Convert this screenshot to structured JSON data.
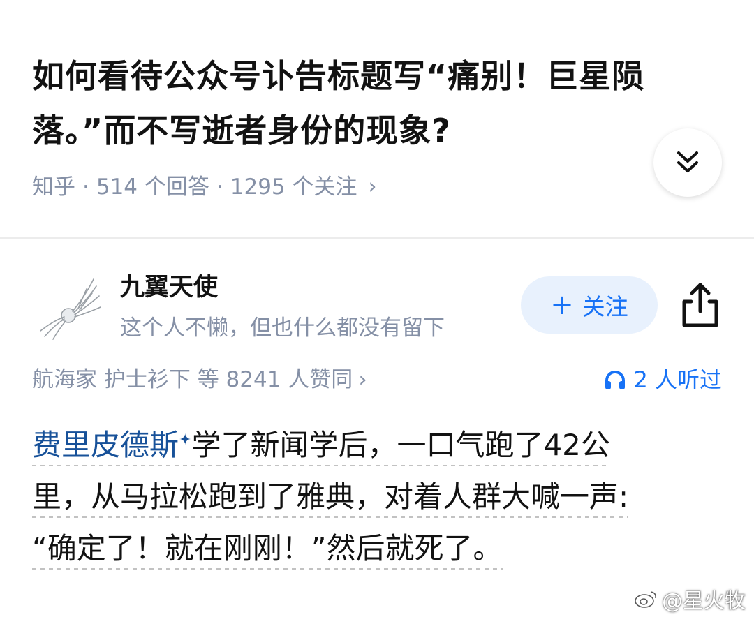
{
  "question": {
    "title": "如何看待公众号讣告标题写“痛别！巨星陨落。”而不写逝者身份的现象?",
    "source": "知乎",
    "answers": "514 个回答",
    "followers": "1295 个关注",
    "meta_separator": "·"
  },
  "author": {
    "name": "九翼天使",
    "bio": "这个人不懒，但也什么都没有留下",
    "follow_label": "关注"
  },
  "answer": {
    "upvote_text": "航海家 护士衫下 等 8241 人赞同",
    "listened_text": "2 人听过",
    "link_text": "费里皮德斯",
    "lines": [
      "学了新闻学后，一口气跑了42公",
      "里，从马拉松跑到了雅典，对着人群大喊一声:",
      "“确定了！就在刚刚！”然后就死了。"
    ]
  },
  "watermark": "@星火牧",
  "colors": {
    "accent": "#1772f6",
    "link": "#175199",
    "meta_gray": "#8590a6",
    "follow_bg": "#e8f1fd"
  },
  "icons": [
    "expand-down-icon",
    "plus-icon",
    "share-icon",
    "headphones-icon",
    "weibo-icon",
    "chevron-right-icon"
  ]
}
